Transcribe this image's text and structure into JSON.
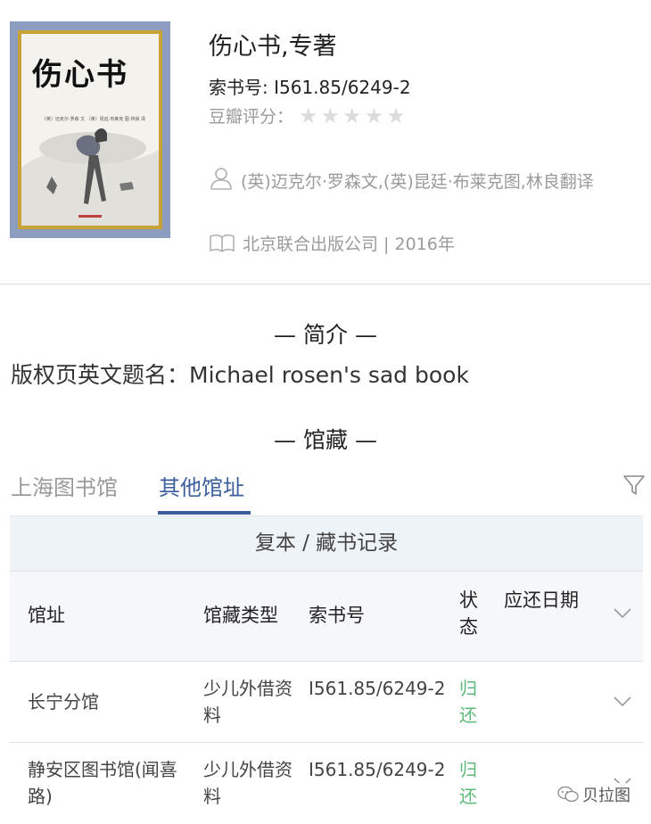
{
  "book": {
    "cover_title": "伤心书",
    "cover_byline": "〔英〕迈克尔·罗森 文 〔英〕昆廷·布莱克 图 林良 译",
    "title": "伤心书,专著",
    "call_number": "索书号: I561.85/6249-2",
    "rating_label": "豆瓣评分：",
    "rating_stars": 0,
    "author": "(英)迈克尔·罗森文,(英)昆廷·布莱克图,林良翻译",
    "publisher": "北京联合出版公司 | 2016年"
  },
  "intro": {
    "heading": "— 简介 —",
    "text": "版权页英文题名：Michael rosen's sad book"
  },
  "holdings": {
    "heading": "— 馆藏 —",
    "tabs": [
      "上海图书馆",
      "其他馆址"
    ],
    "active_tab": 1,
    "table_caption": "复本 / 藏书记录",
    "columns": [
      "馆址",
      "馆藏类型",
      "索书号",
      "状态",
      "应还日期"
    ],
    "rows": [
      {
        "location": "长宁分馆",
        "type": "少儿外借资料",
        "call": "I561.85/6249-2",
        "status": "归还",
        "due": ""
      },
      {
        "location": "静安区图书馆(闻喜路)",
        "type": "少儿外借资料",
        "call": "I561.85/6249-2",
        "status": "归还",
        "due": ""
      }
    ]
  },
  "watermark": "贝拉图",
  "colors": {
    "accent": "#3a5f9c",
    "status_ok": "#5db97a",
    "muted": "#9a9a9a",
    "cover_bg": "#8c9dc0",
    "cover_frame": "#c9a237"
  },
  "icons": [
    "person-icon",
    "book-open-icon",
    "filter-icon",
    "chevron-down-icon",
    "wechat-icon",
    "star-icon"
  ]
}
